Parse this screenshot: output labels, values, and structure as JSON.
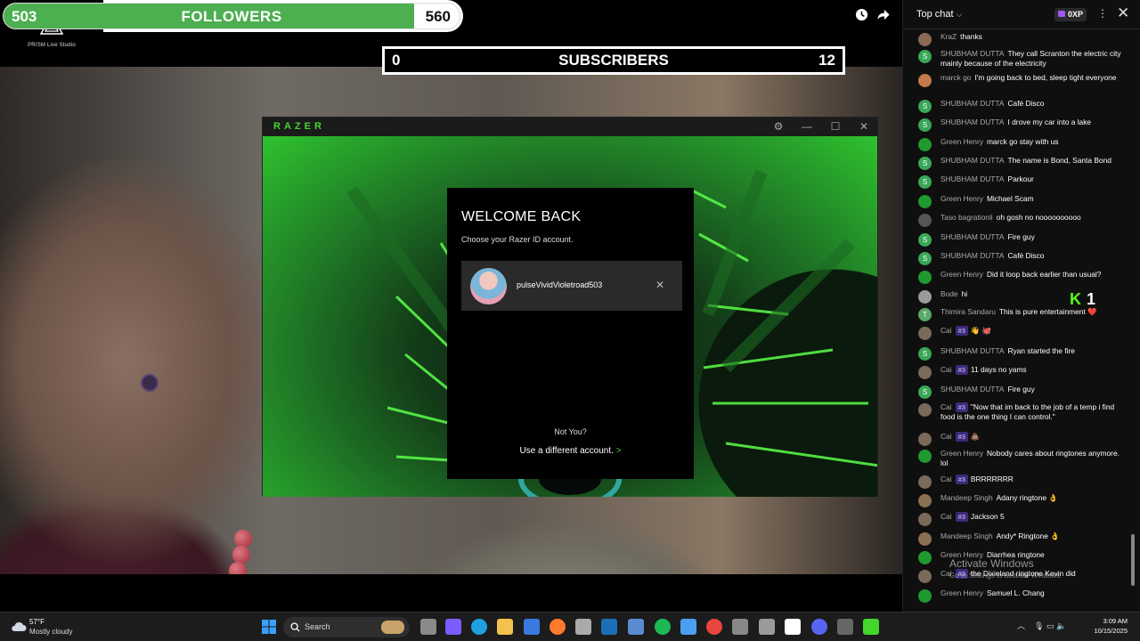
{
  "stream": {
    "logo_text": "PRISM Live Studio",
    "followers": {
      "label": "FOLLOWERS",
      "current": "503",
      "goal": "560",
      "progress": 0.9
    },
    "subscribers": {
      "label": "SUBSCRIBERS",
      "current": "0",
      "goal": "12",
      "progress": 0
    }
  },
  "razer": {
    "brand": "RAZER",
    "heading": "WELCOME BACK",
    "subheading": "Choose your Razer ID account.",
    "account_name": "pulseVividVioletroad503",
    "not_you": "Not You?",
    "use_different": "Use a different account.",
    "use_different_arrow": ">"
  },
  "chat": {
    "title": "Top chat",
    "xp_label": "0XP",
    "kick_count": "1",
    "messages": [
      {
        "author": "KraZ",
        "text": "thanks",
        "avatar": "",
        "color": "#8a6a55",
        "badge": ""
      },
      {
        "author": "SHUBHAM DUTTA",
        "text": "They call Scranton the electric city mainly because of the electricity",
        "avatar": "S",
        "color": "#3aa757",
        "badge": ""
      },
      {
        "author": "marck go",
        "text": "I'm going back to bed, sleep tight everyone",
        "avatar": "",
        "color": "#c27a4a",
        "badge": ""
      },
      {
        "author": "SHUBHAM DUTTA",
        "text": "Café Disco",
        "avatar": "S",
        "color": "#3aa757",
        "badge": ""
      },
      {
        "author": "SHUBHAM DUTTA",
        "text": "I drove my car into a lake",
        "avatar": "S",
        "color": "#3aa757",
        "badge": ""
      },
      {
        "author": "Green Henry",
        "text": "marck go stay with us",
        "avatar": "",
        "color": "#1f9a2e",
        "badge": ""
      },
      {
        "author": "SHUBHAM DUTTA",
        "text": "The name is Bond, Santa Bond",
        "avatar": "S",
        "color": "#3aa757",
        "badge": ""
      },
      {
        "author": "SHUBHAM DUTTA",
        "text": "Parkour",
        "avatar": "S",
        "color": "#3aa757",
        "badge": ""
      },
      {
        "author": "Green Henry",
        "text": "Michael Scam",
        "avatar": "",
        "color": "#1f9a2e",
        "badge": ""
      },
      {
        "author": "Taso bagrationli",
        "text": "oh gosh no noooooooooo",
        "avatar": "",
        "color": "#555555",
        "badge": ""
      },
      {
        "author": "SHUBHAM DUTTA",
        "text": "Fire guy",
        "avatar": "S",
        "color": "#3aa757",
        "badge": ""
      },
      {
        "author": "SHUBHAM DUTTA",
        "text": "Café Disco",
        "avatar": "S",
        "color": "#3aa757",
        "badge": ""
      },
      {
        "author": "Green Henry",
        "text": "Did it loop back earlier than usual?",
        "avatar": "",
        "color": "#1f9a2e",
        "badge": ""
      },
      {
        "author": "Bode",
        "text": "hi",
        "avatar": "",
        "color": "#9a9a9a",
        "badge": ""
      },
      {
        "author": "Thimira Sandaru",
        "text": "This is pure entertainment ❤️",
        "avatar": "T",
        "color": "#5aa86a",
        "badge": ""
      },
      {
        "author": "Cai",
        "text": "👋 🐙",
        "avatar": "",
        "color": "#7a6a5a",
        "badge": "#3"
      },
      {
        "author": "SHUBHAM DUTTA",
        "text": "Ryan started the fire",
        "avatar": "S",
        "color": "#3aa757",
        "badge": ""
      },
      {
        "author": "Cai",
        "text": "11 days no yams",
        "avatar": "",
        "color": "#7a6a5a",
        "badge": "#3"
      },
      {
        "author": "SHUBHAM DUTTA",
        "text": "Fire guy",
        "avatar": "S",
        "color": "#3aa757",
        "badge": ""
      },
      {
        "author": "Cai",
        "text": "\"Now that im back to the job of a temp i find food is the one thing I can control.\"",
        "avatar": "",
        "color": "#7a6a5a",
        "badge": "#3"
      },
      {
        "author": "Cai",
        "text": "💩",
        "avatar": "",
        "color": "#7a6a5a",
        "badge": "#3"
      },
      {
        "author": "Green Henry",
        "text": "Nobody cares about ringtones anymore. lol",
        "avatar": "",
        "color": "#1f9a2e",
        "badge": ""
      },
      {
        "author": "Cai",
        "text": "BRRRRRRR",
        "avatar": "",
        "color": "#7a6a5a",
        "badge": "#3"
      },
      {
        "author": "Mandeep Singh",
        "text": "Adany ringtone 👌",
        "avatar": "",
        "color": "#8a7050",
        "badge": ""
      },
      {
        "author": "Cai",
        "text": "Jackson 5",
        "avatar": "",
        "color": "#7a6a5a",
        "badge": "#3"
      },
      {
        "author": "Mandeep Singh",
        "text": "Andy* Ringtone 👌",
        "avatar": "",
        "color": "#8a7050",
        "badge": ""
      },
      {
        "author": "Green Henry",
        "text": "Diarrhea ringtone",
        "avatar": "",
        "color": "#1f9a2e",
        "badge": ""
      },
      {
        "author": "Cai",
        "text": "the Dixieland ringtone Kevin did",
        "avatar": "",
        "color": "#7a6a5a",
        "badge": "#3"
      },
      {
        "author": "Green Henry",
        "text": "Samuel L. Chang",
        "avatar": "",
        "color": "#1f9a2e",
        "badge": ""
      }
    ],
    "activate_title": "Activate Windows",
    "activate_sub": "Go to Settings to activate Windows."
  },
  "taskbar": {
    "temperature": "57°F",
    "condition": "Mostly cloudy",
    "search_placeholder": "Search",
    "time": "3:09 AM",
    "date": "10/15/2025",
    "apps": [
      "widgets-icon",
      "task-view-icon",
      "copilot-icon",
      "edge-icon",
      "file-explorer-icon",
      "store-icon",
      "firefox-icon",
      "app-icon",
      "steam-icon",
      "app2-icon",
      "spotify-icon",
      "app3-icon",
      "chrome-icon",
      "terminal-icon",
      "app4-icon",
      "tiktok-icon",
      "discord-icon",
      "app5-icon",
      "razer-icon"
    ]
  }
}
